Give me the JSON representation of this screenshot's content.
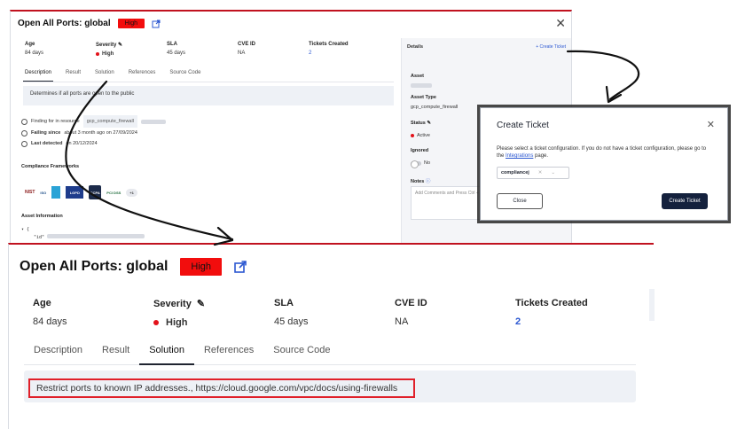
{
  "top_panel": {
    "title": "Open All Ports: global",
    "severity_badge": "High",
    "meta": [
      {
        "label": "Age",
        "value": "84 days"
      },
      {
        "label": "Severity",
        "value": "High"
      },
      {
        "label": "SLA",
        "value": "45 days"
      },
      {
        "label": "CVE ID",
        "value": "NA"
      },
      {
        "label": "Tickets Created",
        "value": "2"
      }
    ],
    "tabs": [
      "Description",
      "Result",
      "Solution",
      "References",
      "Source Code"
    ],
    "description": "Determines if all ports are open to the public",
    "finding_label": "Finding for in resource",
    "finding_resource": "gcp_compute_firewall",
    "failing_since_label": "Failing since",
    "failing_since_text": "about 3 month ago on 27/09/2024",
    "last_detected_label": "Last detected",
    "last_detected_text": "on 20/12/2024",
    "compliance_title": "Compliance Frameworks",
    "compliance_logos": [
      "NIST",
      "ISO",
      "LGPD",
      "CCPA",
      "PCI DSS"
    ],
    "compliance_more": "+1",
    "asset_info_title": "Asset Information",
    "json_open": "{",
    "json_key": "\"id\"",
    "details": {
      "header": "Details",
      "create_ticket": "+ Create Ticket",
      "asset_label": "Asset",
      "asset_type_label": "Asset Type",
      "asset_type_value": "gcp_compute_firewall",
      "status_label": "Status",
      "status_value": "Active",
      "ignored_label": "Ignored",
      "ignored_value": "No",
      "notes_label": "Notes",
      "notes_placeholder": "Add Comments and Press Ctrl + Enter"
    }
  },
  "modal": {
    "title": "Create Ticket",
    "text_before_link": "Please select a ticket configuration. If you do not have a ticket configuration, please go to the ",
    "link": "Integrations",
    "text_after_link": " page.",
    "select_value": "compliancej",
    "close_button": "Close",
    "create_button": "Create Ticket"
  },
  "bottom_panel": {
    "title": "Open All Ports: global",
    "severity_badge": "High",
    "meta": [
      {
        "label": "Age",
        "value": "84 days"
      },
      {
        "label": "Severity",
        "value": "High"
      },
      {
        "label": "SLA",
        "value": "45 days"
      },
      {
        "label": "CVE ID",
        "value": "NA"
      },
      {
        "label": "Tickets Created",
        "value": "2"
      }
    ],
    "tabs": [
      "Description",
      "Result",
      "Solution",
      "References",
      "Source Code"
    ],
    "active_tab": "Solution",
    "solution_text": "Restrict ports to known IP addresses., https://cloud.google.com/vpc/docs/using-firewalls"
  },
  "colors": {
    "severity_high": "#f20d0d",
    "accent_link": "#2b57d1",
    "highlight_box": "#e0202a",
    "primary_button": "#14213d"
  }
}
